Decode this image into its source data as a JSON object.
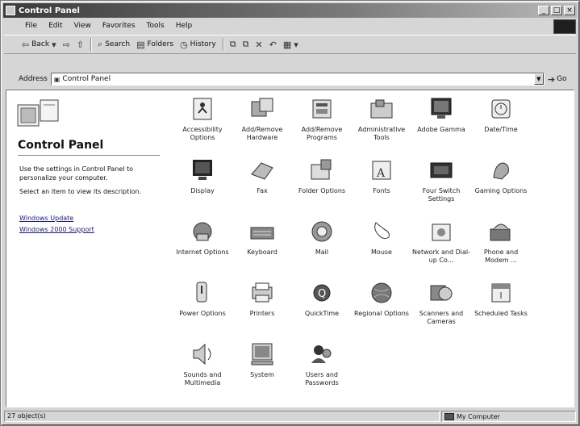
{
  "window": {
    "title": "Control Panel"
  },
  "menu": [
    "File",
    "Edit",
    "View",
    "Favorites",
    "Tools",
    "Help"
  ],
  "toolbar": {
    "back": "Back",
    "search": "Search",
    "folders": "Folders",
    "history": "History"
  },
  "address": {
    "label": "Address",
    "value": "Control Panel",
    "go": "Go"
  },
  "leftpane": {
    "title": "Control Panel",
    "desc1": "Use the settings in Control Panel to personalize your computer.",
    "desc2": "Select an item to view its description.",
    "link1": "Windows Update",
    "link2": "Windows 2000 Support"
  },
  "items": [
    {
      "label": "Accessibility Options",
      "icon": "accessibility-icon"
    },
    {
      "label": "Add/Remove Hardware",
      "icon": "add-hardware-icon"
    },
    {
      "label": "Add/Remove Programs",
      "icon": "add-programs-icon"
    },
    {
      "label": "Administrative Tools",
      "icon": "admin-tools-icon"
    },
    {
      "label": "Adobe Gamma",
      "icon": "adobe-gamma-icon"
    },
    {
      "label": "Date/Time",
      "icon": "date-time-icon"
    },
    {
      "label": "Display",
      "icon": "display-icon"
    },
    {
      "label": "Fax",
      "icon": "fax-icon"
    },
    {
      "label": "Folder Options",
      "icon": "folder-options-icon"
    },
    {
      "label": "Fonts",
      "icon": "fonts-icon"
    },
    {
      "label": "Four Switch Settings",
      "icon": "four-switch-icon"
    },
    {
      "label": "Gaming Options",
      "icon": "gaming-icon"
    },
    {
      "label": "Internet Options",
      "icon": "internet-options-icon"
    },
    {
      "label": "Keyboard",
      "icon": "keyboard-icon"
    },
    {
      "label": "Mail",
      "icon": "mail-icon"
    },
    {
      "label": "Mouse",
      "icon": "mouse-icon"
    },
    {
      "label": "Network and Dial-up Co...",
      "icon": "network-icon"
    },
    {
      "label": "Phone and Modem ...",
      "icon": "phone-modem-icon"
    },
    {
      "label": "Power Options",
      "icon": "power-options-icon"
    },
    {
      "label": "Printers",
      "icon": "printers-icon"
    },
    {
      "label": "QuickTime",
      "icon": "quicktime-icon"
    },
    {
      "label": "Regional Options",
      "icon": "regional-options-icon"
    },
    {
      "label": "Scanners and Cameras",
      "icon": "scanners-icon"
    },
    {
      "label": "Scheduled Tasks",
      "icon": "scheduled-tasks-icon"
    },
    {
      "label": "Sounds and Multimedia",
      "icon": "sounds-icon"
    },
    {
      "label": "System",
      "icon": "system-icon"
    },
    {
      "label": "Users and Passwords",
      "icon": "users-icon"
    }
  ],
  "status": {
    "count": "27 object(s)",
    "zone": "My Computer"
  }
}
